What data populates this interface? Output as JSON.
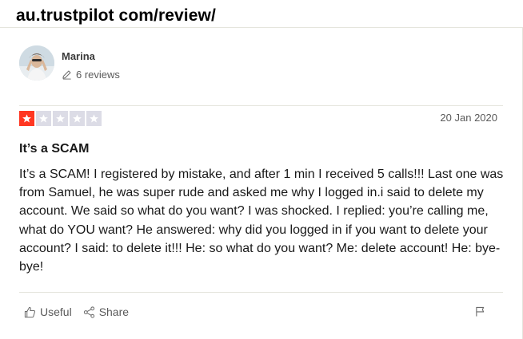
{
  "url_text": "au.trustpilot com/review/",
  "reviewer": {
    "name": "Marina",
    "reviews_count": "6 reviews"
  },
  "review": {
    "rating": 1,
    "rating_max": 5,
    "date": "20 Jan 2020",
    "title": "It’s a SCAM",
    "body": "It’s a SCAM! I registered by mistake, and after 1 min I received 5 calls!!! Last one was from Samuel, he was super rude and asked me why I logged in.i said to delete my account. We said so what do you want? I was shocked. I replied: you’re calling me, what do YOU want? He answered: why did you logged in if you want to delete your account? I said: to delete it!!! He: so what do you want? Me: delete account! He: bye-bye!"
  },
  "actions": {
    "useful_label": "Useful",
    "share_label": "Share"
  },
  "colors": {
    "star_filled": "#ff3722",
    "star_empty": "#dcdce6",
    "text_primary": "#191919",
    "text_secondary": "#5a5a5a"
  },
  "icons": [
    "pencil-icon",
    "thumbs-up-icon",
    "share-icon",
    "flag-icon"
  ]
}
